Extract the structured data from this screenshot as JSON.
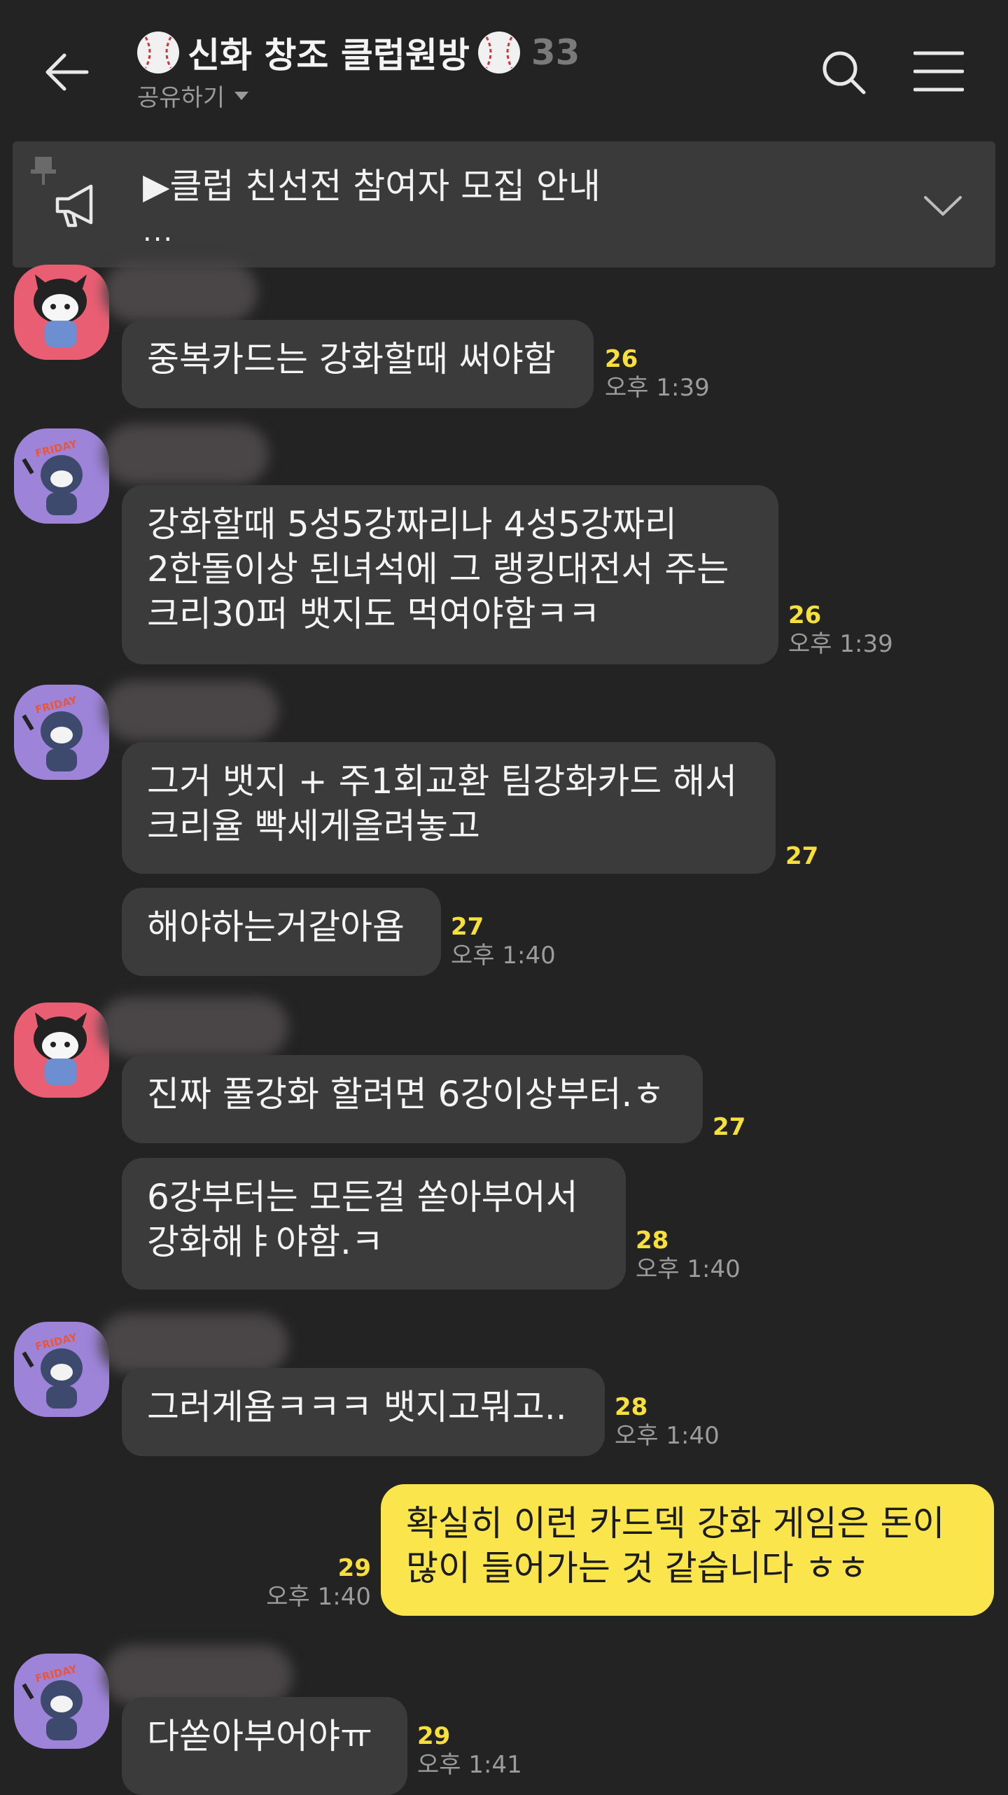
{
  "header": {
    "title": "신화 창조 클럽원방",
    "member_count": "33",
    "share_label": "공유하기",
    "icons": {
      "back": "back-arrow-icon",
      "search": "search-icon",
      "menu": "menu-icon",
      "title_decor": "baseball-icon"
    }
  },
  "notice": {
    "title": "▶클럽 친선전 참여자 모집 안내",
    "more": "...",
    "icons": {
      "pin": "pin-icon",
      "megaphone": "megaphone-icon",
      "expand": "chevron-down-icon"
    }
  },
  "colors": {
    "background": "#232323",
    "bubble_other": "#3b3b3b",
    "bubble_mine": "#fae64c",
    "unread": "#f7e03c",
    "avatar_red": "#e95e73",
    "avatar_purple": "#9d84d9"
  },
  "messages": [
    {
      "text": "중복카드는 강화할때 써야함",
      "unread": "26",
      "time": "오후 1:39"
    },
    {
      "text": "강화할때 5성5강짜리나 4성5강짜리\n2한돌이상 된녀석에 그 랭킹대전서 주는\n크리30퍼 뱃지도 먹여야함ㅋㅋ",
      "unread": "26",
      "time": "오후 1:39"
    },
    {
      "text": "그거 뱃지 + 주1회교환 팀강화카드 해서\n크리율 빡세게올려놓고",
      "unread": "27",
      "time": ""
    },
    {
      "text": "해야하는거같아욤",
      "unread": "27",
      "time": "오후 1:40"
    },
    {
      "text": "진짜 풀강화 할려면 6강이상부터.ㅎ",
      "unread": "27",
      "time": ""
    },
    {
      "text": "6강부터는 모든걸 쏟아부어서\n강화해ㅑ야함.ㅋ",
      "unread": "28",
      "time": "오후 1:40"
    },
    {
      "text": "그러게욤ㅋㅋㅋ 뱃지고뭐고..",
      "unread": "28",
      "time": "오후 1:40"
    },
    {
      "text": "확실히 이런 카드덱 강화 게임은 돈이\n많이 들어가는 것 같습니다 ㅎㅎ",
      "unread": "29",
      "time": "오후 1:40"
    },
    {
      "text": "다쏟아부어야ㅠ",
      "unread": "29",
      "time": "오후 1:41"
    }
  ]
}
